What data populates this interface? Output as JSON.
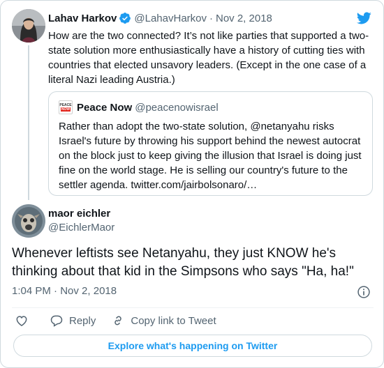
{
  "parent_tweet": {
    "author_name": "Lahav Harkov",
    "author_handle": "@LahavHarkov",
    "separator": "·",
    "date": "Nov 2, 2018",
    "text": "How are the two connected? It’s not like parties that supported a two-state solution more enthusiastically have a history of cutting ties with countries that elected unsavory leaders. (Except in the one case of a literal Nazi leading Austria.)",
    "quoted": {
      "logo_top": "PEACE",
      "logo_bottom": "NOW",
      "author_name": "Peace Now",
      "author_handle": "@peacenowisrael",
      "text": "Rather than adopt the two-state solution, @netanyahu risks Israel's future by throwing his support behind the newest autocrat on the block just to keep giving the illusion that Israel is doing just fine on the world stage. He is selling our country's future to the settler agenda. twitter.com/jairbolsonaro/…"
    }
  },
  "main_tweet": {
    "author_name": "maor eichler",
    "author_handle": "@EichlerMaor",
    "text": "Whenever leftists see Netanyahu, they just KNOW he's thinking about that kid in the Simpsons who says \"Ha, ha!\"",
    "time": "1:04 PM",
    "separator": "·",
    "date": "Nov 2, 2018"
  },
  "actions": {
    "reply_label": "Reply",
    "copy_label": "Copy link to Tweet",
    "explore_label": "Explore what's happening on Twitter"
  },
  "colors": {
    "accent": "#1d9bf0",
    "secondary_text": "#536471",
    "border": "#cfd9de"
  },
  "icons": [
    "verified-badge-icon",
    "twitter-bird-icon",
    "info-icon",
    "heart-icon",
    "reply-icon",
    "copy-link-icon"
  ]
}
